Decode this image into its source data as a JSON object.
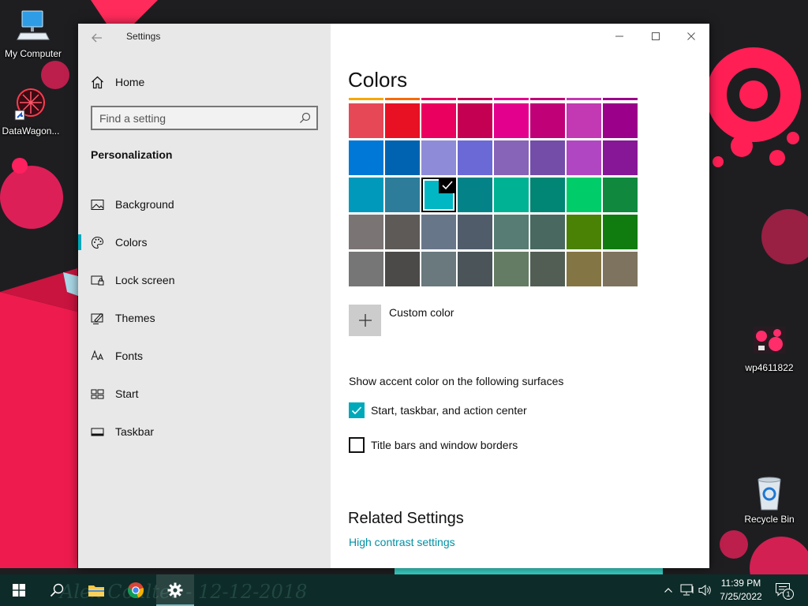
{
  "desktop": {
    "icons": [
      {
        "name": "my-computer",
        "label": "My Computer"
      },
      {
        "name": "datawagon",
        "label": "DataWagon..."
      },
      {
        "name": "wp4611822",
        "label": "wp4611822"
      },
      {
        "name": "recycle-bin",
        "label": "Recycle Bin"
      }
    ],
    "wallpaper_signature": "Alex  Coulter - 12-12-2018"
  },
  "window": {
    "app_title": "Settings",
    "sidebar": {
      "home_label": "Home",
      "search_placeholder": "Find a setting",
      "section_title": "Personalization",
      "items": [
        {
          "label": "Background",
          "icon": "picture-icon",
          "active": false
        },
        {
          "label": "Colors",
          "icon": "palette-icon",
          "active": true
        },
        {
          "label": "Lock screen",
          "icon": "lock-screen-icon",
          "active": false
        },
        {
          "label": "Themes",
          "icon": "themes-icon",
          "active": false
        },
        {
          "label": "Fonts",
          "icon": "fonts-icon",
          "active": false
        },
        {
          "label": "Start",
          "icon": "start-icon",
          "active": false
        },
        {
          "label": "Taskbar",
          "icon": "taskbar-icon",
          "active": false
        }
      ]
    },
    "main": {
      "page_title": "Colors",
      "swatch_rows": [
        [
          "#e74856",
          "#e81123",
          "#ea005e",
          "#c30052",
          "#e3008c",
          "#bf0077",
          "#c239b3",
          "#9a0089"
        ],
        [
          "#0078d7",
          "#0063b1",
          "#8e8cd8",
          "#6b69d6",
          "#8764b8",
          "#744da9",
          "#b146c2",
          "#881798"
        ],
        [
          "#0099bc",
          "#2d7d9a",
          "#00b7c3",
          "#038387",
          "#00b294",
          "#018574",
          "#00cc6a",
          "#10893e"
        ],
        [
          "#7a7574",
          "#5d5a58",
          "#68768a",
          "#515c6b",
          "#567c73",
          "#486860",
          "#498205",
          "#107c10"
        ],
        [
          "#767676",
          "#4c4a48",
          "#69797e",
          "#4a5459",
          "#647c64",
          "#525e54",
          "#847545",
          "#7e735f"
        ]
      ],
      "strip_colors": [
        "#f7a700",
        "#f56a00",
        "#ea005e",
        "#c30052",
        "#e3008c",
        "#bf0077",
        "#c239b3",
        "#9a0089"
      ],
      "selected_swatch": {
        "row": 2,
        "col": 2,
        "color": "#00b7c3"
      },
      "custom_color_label": "Custom color",
      "surfaces_label": "Show accent color on the following surfaces",
      "checkbox_start_label": "Start, taskbar, and action center",
      "checkbox_start_checked": true,
      "checkbox_title_label": "Title bars and window borders",
      "checkbox_title_checked": false,
      "related_title": "Related Settings",
      "related_link": "High contrast settings",
      "accent_color": "#00a9ba"
    }
  },
  "taskbar": {
    "time": "11:39 PM",
    "date": "7/25/2022",
    "notification_count": "1"
  }
}
